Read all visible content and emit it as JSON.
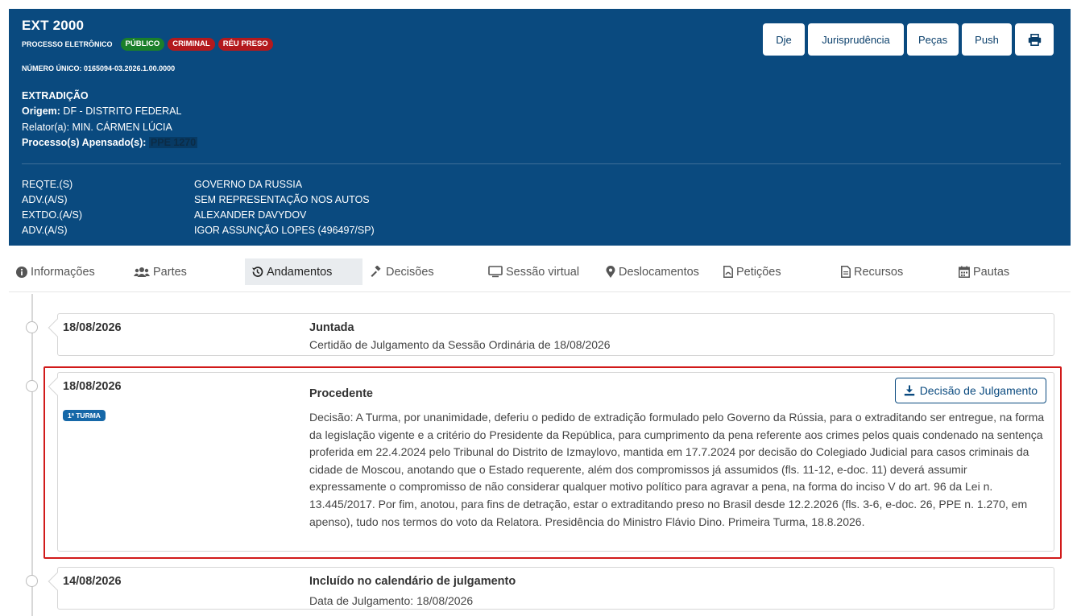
{
  "header": {
    "title": "EXT 2000",
    "badge_plain": "PROCESSO ELETRÔNICO",
    "badges": [
      "PÚBLICO",
      "CRIMINAL",
      "RÉU PRESO"
    ],
    "numero_unico": "NÚMERO ÚNICO: 0165094-03.2026.1.00.0000",
    "classe": "EXTRADIÇÃO",
    "origem_label": "Origem:",
    "origem_value": "DF - DISTRITO FEDERAL",
    "relator": "Relator(a): MIN. CÁRMEN LÚCIA",
    "apensados_label": "Processo(s) Apensado(s):",
    "apensados_value": "PPE 1270",
    "partes": [
      {
        "label": "REQTE.(S)",
        "value": "GOVERNO DA RUSSIA"
      },
      {
        "label": "ADV.(A/S)",
        "value": "SEM REPRESENTAÇÃO NOS AUTOS"
      },
      {
        "label": "EXTDO.(A/S)",
        "value": "ALEXANDER DAVYDOV"
      },
      {
        "label": "ADV.(A/S)",
        "value": "IGOR ASSUNÇÃO LOPES (496497/SP)"
      }
    ]
  },
  "toolbar": {
    "dje": "Dje",
    "jurisprudencia": "Jurisprudência",
    "pecas": "Peças",
    "push": "Push",
    "print_icon": "print-icon"
  },
  "tabs": [
    {
      "label": "Informações",
      "icon": "info-icon"
    },
    {
      "label": "Partes",
      "icon": "users-icon"
    },
    {
      "label": "Andamentos",
      "icon": "history-icon",
      "active": true
    },
    {
      "label": "Decisões",
      "icon": "gavel-icon"
    },
    {
      "label": "Sessão virtual",
      "icon": "monitor-icon"
    },
    {
      "label": "Deslocamentos",
      "icon": "map-marker-icon"
    },
    {
      "label": "Petições",
      "icon": "pdf-file-icon"
    },
    {
      "label": "Recursos",
      "icon": "file-icon"
    },
    {
      "label": "Pautas",
      "icon": "calendar-icon"
    }
  ],
  "timeline": [
    {
      "date": "18/08/2026",
      "title": "Juntada",
      "text": "Certidão de Julgamento da Sessão Ordinária de 18/08/2026"
    },
    {
      "date": "18/08/2026",
      "badge": "1ª TURMA",
      "title": "Procedente",
      "button": "Decisão de Julgamento",
      "text": "Decisão: A Turma, por unanimidade, deferiu o pedido de extradição formulado pelo Governo da Rússia, para o extraditando ser entregue, na forma da legislação vigente e a critério do Presidente da República, para cumprimento da pena referente aos crimes pelos quais condenado na sentença proferida em 22.4.2024 pelo Tribunal do Distrito de Izmaylovo, mantida em 17.7.2024 por decisão do Colegiado Judicial para casos criminais da cidade de Moscou, anotando que o Estado requerente, além dos compromissos já assumidos (fls. 11-12, e-doc. 11) deverá assumir expressamente o compromisso de não considerar qualquer motivo político para agravar a pena, na forma do inciso V do art. 96 da Lei n. 13.445/2017. Por fim, anotou, para fins de detração, estar o extraditando preso no Brasil desde 12.2.2026 (fls. 3-6, e-doc. 26, PPE n. 1.270, em apenso), tudo nos termos do voto da Relatora. Presidência do Ministro Flávio Dino. Primeira Turma, 18.8.2026."
    },
    {
      "date": "14/08/2026",
      "title": "Incluído no calendário de julgamento",
      "text": "Data de Julgamento: 18/08/2026"
    }
  ],
  "colors": {
    "header_bg": "#0a4a7f",
    "highlight": "#d11a1a"
  }
}
